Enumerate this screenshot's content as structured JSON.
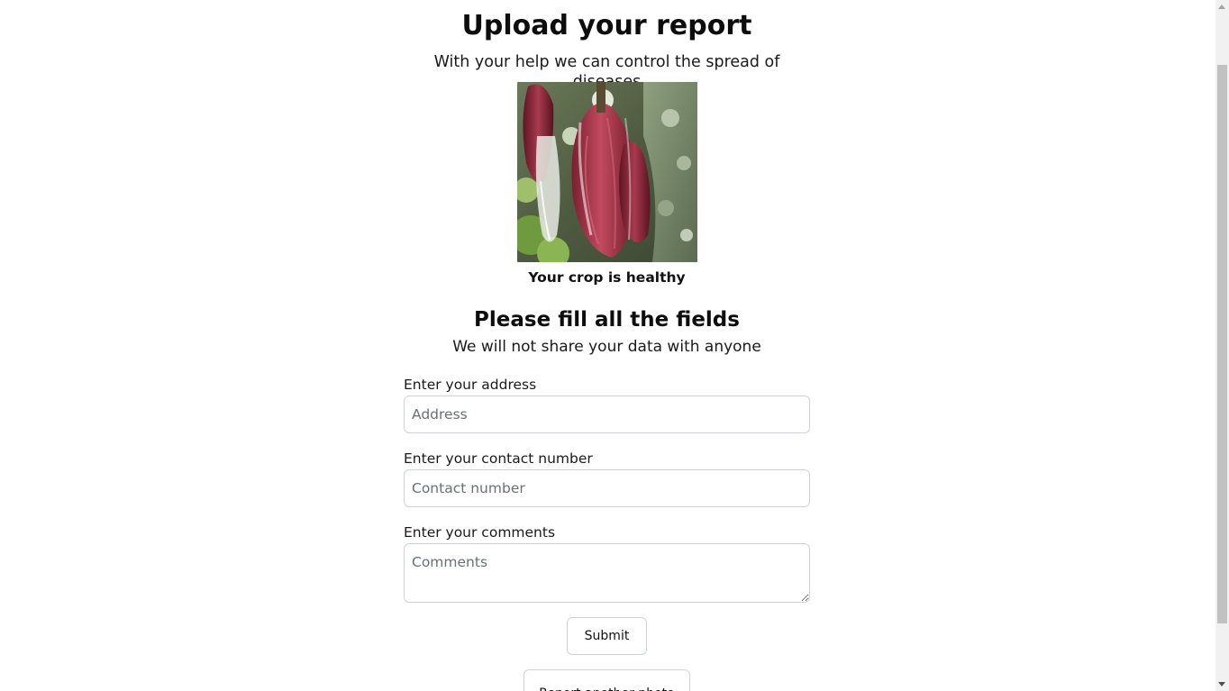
{
  "header": {
    "title": "Upload your report",
    "subtitle": "With your help we can control the spread of diseases"
  },
  "result": {
    "label": "Your crop is healthy"
  },
  "form": {
    "title": "Please fill all the fields",
    "subtitle": "We will not share your data with anyone",
    "address_label": "Enter your address",
    "address_placeholder": "Address",
    "contact_label": "Enter your contact number",
    "contact_placeholder": "Contact number",
    "comments_label": "Enter your comments",
    "comments_placeholder": "Comments",
    "submit_label": "Submit",
    "report_another_label": "Report another photo"
  },
  "colors": {
    "text": "#111111",
    "input_border": "#cfd3d8",
    "scrollbar_thumb": "#c1c1c1"
  }
}
